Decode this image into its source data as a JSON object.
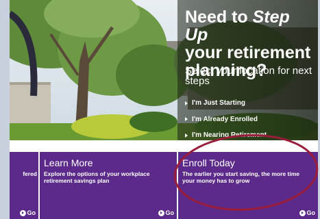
{
  "hero": {
    "headline_line1_pre": "Need to ",
    "headline_line1_em": "Step Up",
    "headline_line2": "your retirement",
    "headline_line3": "planning?",
    "subheadline": "Select your location for next steps",
    "steps": [
      {
        "label": "I'm Just Starting"
      },
      {
        "label": "I'm Already Enrolled"
      },
      {
        "label": "I'm Nearing Retirement"
      }
    ]
  },
  "panels": [
    {
      "title": "",
      "description": "fered",
      "go_label": "Go"
    },
    {
      "title": "Learn More",
      "description": "Explore the options of your workplace retirement savings plan",
      "go_label": "Go"
    },
    {
      "title": "Enroll Today",
      "description": "The earlier you start saving, the more time your money has to grow",
      "go_label": "Go"
    }
  ],
  "colors": {
    "panel_purple": "#5c2a8a",
    "highlight_circle": "#9b1d3c"
  }
}
